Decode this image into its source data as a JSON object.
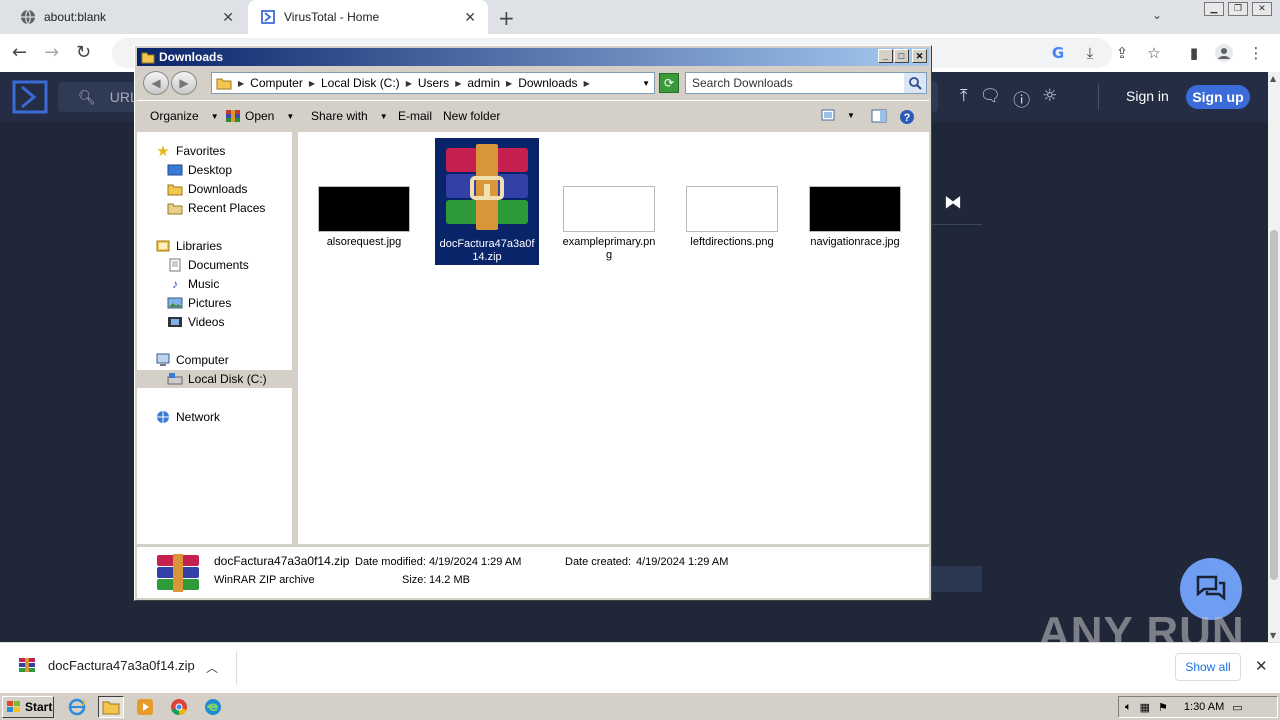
{
  "browser": {
    "tabs": [
      {
        "title": "about:blank"
      },
      {
        "title": "VirusTotal - Home"
      }
    ]
  },
  "virustotal": {
    "search_placeholder": "URL",
    "sign_in": "Sign in",
    "sign_up": "Sign up"
  },
  "explorer": {
    "title": "Downloads",
    "breadcrumbs": [
      "Computer",
      "Local Disk (C:)",
      "Users",
      "admin",
      "Downloads"
    ],
    "search_placeholder": "Search Downloads",
    "commands": {
      "organize": "Organize",
      "open": "Open",
      "share_with": "Share with",
      "email": "E-mail",
      "new_folder": "New folder"
    },
    "nav": {
      "favorites": "Favorites",
      "desktop": "Desktop",
      "downloads": "Downloads",
      "recent_places": "Recent Places",
      "libraries": "Libraries",
      "documents": "Documents",
      "music": "Music",
      "pictures": "Pictures",
      "videos": "Videos",
      "computer": "Computer",
      "local_disk": "Local Disk (C:)",
      "network": "Network"
    },
    "files": [
      {
        "name": "alsorequest.jpg"
      },
      {
        "name": "docFactura47a3a0f14.zip"
      },
      {
        "name": "exampleprimary.png"
      },
      {
        "name": "leftdirections.png"
      },
      {
        "name": "navigationrace.jpg"
      }
    ],
    "details": {
      "file_name": "docFactura47a3a0f14.zip",
      "date_modified_label": "Date modified:",
      "date_modified": "4/19/2024 1:29 AM",
      "date_created_label": "Date created:",
      "date_created": "4/19/2024 1:29 AM",
      "type": "WinRAR ZIP archive",
      "size_label": "Size:",
      "size": "14.2 MB"
    }
  },
  "download_bar": {
    "file_name": "docFactura47a3a0f14.zip",
    "show_all": "Show all"
  },
  "watermark": "ANY RUN",
  "taskbar": {
    "start": "Start",
    "clock": "1:30 AM"
  },
  "colors": {
    "vt_background": "#1f2739",
    "vt_accent": "#3b6bd9",
    "selection": "#0a246a"
  }
}
